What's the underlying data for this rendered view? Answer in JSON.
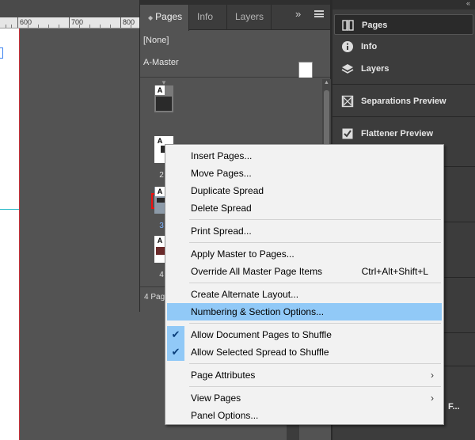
{
  "ruler": {
    "marks": [
      "600",
      "700",
      "800"
    ]
  },
  "pages_panel": {
    "tabs": [
      {
        "label": "Pages",
        "prefix": "◆"
      },
      {
        "label": "Info"
      },
      {
        "label": "Layers"
      }
    ],
    "expand_icon": "»",
    "masters": [
      {
        "label": "[None]"
      },
      {
        "label": "A-Master"
      }
    ],
    "pages": [
      {
        "label": "1",
        "master": "A"
      },
      {
        "label": "2",
        "master": "A"
      },
      {
        "label": "3",
        "master": "A"
      },
      {
        "label": "4",
        "master": "A"
      }
    ],
    "status": "4 Pag"
  },
  "dock": {
    "items": [
      {
        "label": "Pages",
        "icon": "pages-icon"
      },
      {
        "label": "Info",
        "icon": "info-icon"
      },
      {
        "label": "Layers",
        "icon": "layers-icon"
      },
      {
        "label": "Separations Preview",
        "icon": "separations-icon"
      },
      {
        "label": "Flattener Preview",
        "icon": "flattener-icon"
      }
    ],
    "cut_text": "F..."
  },
  "context_menu": {
    "items": [
      {
        "label": "Insert Pages..."
      },
      {
        "label": "Move Pages..."
      },
      {
        "label": "Duplicate Spread"
      },
      {
        "label": "Delete Spread"
      },
      {
        "label": "Print Spread..."
      },
      {
        "label": "Apply Master to Pages..."
      },
      {
        "label": "Override All Master Page Items",
        "shortcut": "Ctrl+Alt+Shift+L"
      },
      {
        "label": "Create Alternate Layout..."
      },
      {
        "label": "Numbering & Section Options..."
      },
      {
        "label": "Allow Document Pages to Shuffle",
        "checked": true
      },
      {
        "label": "Allow Selected Spread to Shuffle",
        "checked": true
      },
      {
        "label": "Page Attributes"
      },
      {
        "label": "View Pages"
      },
      {
        "label": "Panel Options..."
      }
    ],
    "check_glyph": "✔",
    "submenu_glyph": "›"
  },
  "colors": {
    "highlight": "#91c9f7",
    "selected_page_border": "#e11111"
  }
}
